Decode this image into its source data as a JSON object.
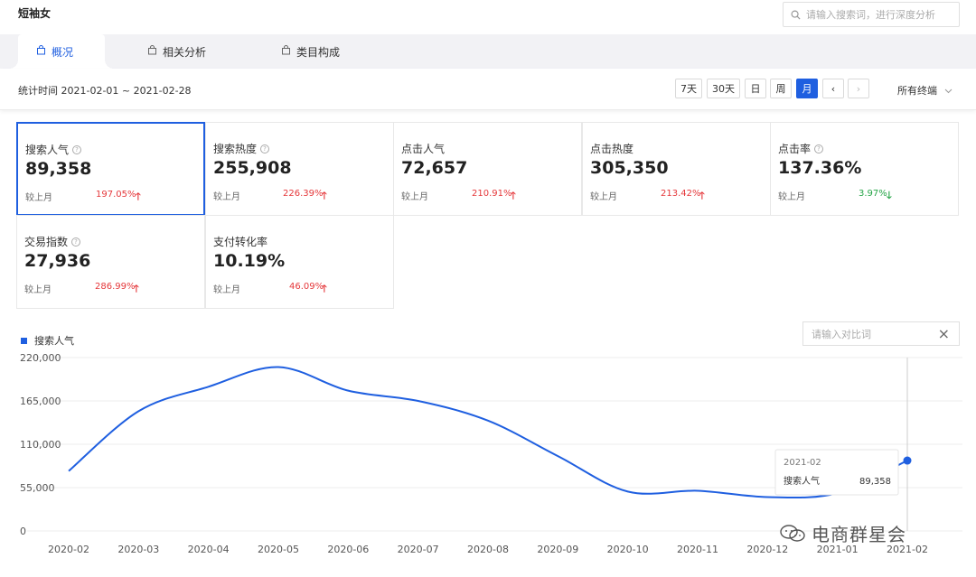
{
  "page": {
    "title": "短袖女",
    "search_placeholder": "请输入搜索词，进行深度分析"
  },
  "tabs": [
    {
      "label": "概况",
      "active": true
    },
    {
      "label": "相关分析",
      "active": false
    },
    {
      "label": "类目构成",
      "active": false
    }
  ],
  "stat": {
    "period": "统计时间 2021-02-01 ~ 2021-02-28",
    "ranges": [
      "7天",
      "30天",
      "日",
      "周",
      "月"
    ],
    "active_range": "月",
    "prev": "‹",
    "next": "›",
    "terminal": "所有终端"
  },
  "metrics": [
    {
      "label": "搜索人气",
      "value": "89,358",
      "compare": "较上月",
      "change": "197.05%",
      "dir": "up"
    },
    {
      "label": "搜索热度",
      "value": "255,908",
      "compare": "较上月",
      "change": "226.39%",
      "dir": "up"
    },
    {
      "label": "点击人气",
      "value": "72,657",
      "compare": "较上月",
      "change": "210.91%",
      "dir": "up"
    },
    {
      "label": "点击热度",
      "value": "305,350",
      "compare": "较上月",
      "change": "213.42%",
      "dir": "up"
    },
    {
      "label": "点击率",
      "value": "137.36%",
      "compare": "较上月",
      "change": "3.97%",
      "dir": "down"
    },
    {
      "label": "交易指数",
      "value": "27,936",
      "compare": "较上月",
      "change": "286.99%",
      "dir": "up"
    },
    {
      "label": "支付转化率",
      "value": "10.19%",
      "compare": "较上月",
      "change": "46.09%",
      "dir": "up"
    }
  ],
  "compare_placeholder": "请输入对比词",
  "colors": {
    "accent": "#1f5fe0",
    "up": "#e5383b",
    "down": "#27a548"
  },
  "chart_data": {
    "type": "line",
    "x": [
      "2020-02",
      "2020-03",
      "2020-04",
      "2020-05",
      "2020-06",
      "2020-07",
      "2020-08",
      "2020-09",
      "2020-10",
      "2020-11",
      "2020-12",
      "2021-01",
      "2021-02"
    ],
    "series": [
      {
        "name": "搜索人气",
        "values": [
          76000,
          152000,
          183000,
          208000,
          178000,
          165000,
          140000,
          95000,
          50000,
          51000,
          43000,
          48000,
          89358
        ]
      }
    ],
    "yticks": [
      "220,000",
      "165,000",
      "110,000",
      "55,000",
      "0"
    ],
    "ylim": [
      0,
      220000
    ],
    "grid": true,
    "tooltip": {
      "x": "2021-02",
      "label": "搜索人气",
      "value": "89,358"
    }
  },
  "watermark": "电商群星会"
}
